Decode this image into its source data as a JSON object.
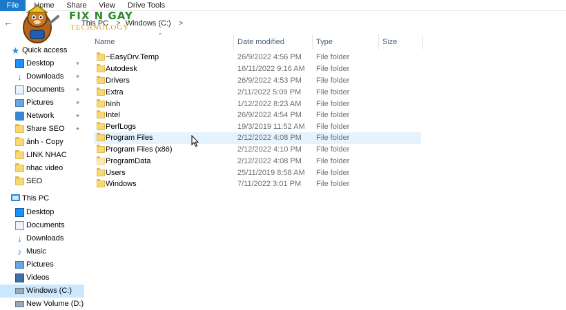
{
  "ribbon": {
    "tabs": [
      "File",
      "Home",
      "Share",
      "View",
      "Drive Tools"
    ]
  },
  "address": {
    "segments": [
      "This PC",
      "Windows (C:)"
    ],
    "separator": ">"
  },
  "logo": {
    "line1": "FIX N GAY",
    "line2": "TECHNOLOGY"
  },
  "columns": {
    "name": "Name",
    "date": "Date modified",
    "type": "Type",
    "size": "Size"
  },
  "nav": {
    "quick_access": "Quick access",
    "items": [
      {
        "label": "Desktop",
        "icon": "desktop-icon",
        "pinned": true
      },
      {
        "label": "Downloads",
        "icon": "download-icon",
        "pinned": true
      },
      {
        "label": "Documents",
        "icon": "documents-icon",
        "pinned": true
      },
      {
        "label": "Pictures",
        "icon": "pictures-icon",
        "pinned": true
      },
      {
        "label": "Network",
        "icon": "network-icon",
        "pinned": true
      },
      {
        "label": "Share SEO",
        "icon": "folder-icon",
        "pinned": true
      },
      {
        "label": "ảnh - Copy",
        "icon": "folder-icon",
        "pinned": false
      },
      {
        "label": "LINK NHAC",
        "icon": "folder-icon",
        "pinned": false
      },
      {
        "label": "nhạc video",
        "icon": "folder-icon",
        "pinned": false
      },
      {
        "label": "SEO",
        "icon": "folder-icon",
        "pinned": false
      }
    ],
    "this_pc": "This PC",
    "pc_items": [
      {
        "label": "Desktop",
        "icon": "desktop-icon"
      },
      {
        "label": "Documents",
        "icon": "documents-icon"
      },
      {
        "label": "Downloads",
        "icon": "download-icon"
      },
      {
        "label": "Music",
        "icon": "music-icon"
      },
      {
        "label": "Pictures",
        "icon": "pictures-icon"
      },
      {
        "label": "Videos",
        "icon": "videos-icon"
      },
      {
        "label": "Windows (C:)",
        "icon": "drive-icon",
        "selected": true
      },
      {
        "label": "New Volume (D:)",
        "icon": "drive-icon"
      }
    ],
    "pin_glyph": "📌"
  },
  "files": [
    {
      "name": "~EasyDrv.Temp",
      "date": "26/9/2022 4:56 PM",
      "type": "File folder"
    },
    {
      "name": "Autodesk",
      "date": "16/11/2022 9:16 AM",
      "type": "File folder"
    },
    {
      "name": "Drivers",
      "date": "26/9/2022 4:53 PM",
      "type": "File folder"
    },
    {
      "name": "Extra",
      "date": "2/11/2022 5:09 PM",
      "type": "File folder"
    },
    {
      "name": "hình",
      "date": "1/12/2022 8:23 AM",
      "type": "File folder"
    },
    {
      "name": "Intel",
      "date": "26/9/2022 4:54 PM",
      "type": "File folder"
    },
    {
      "name": "PerfLogs",
      "date": "19/3/2019 11:52 AM",
      "type": "File folder"
    },
    {
      "name": "Program Files",
      "date": "2/12/2022 4:08 PM",
      "type": "File folder",
      "hover": true
    },
    {
      "name": "Program Files (x86)",
      "date": "2/12/2022 4:10 PM",
      "type": "File folder"
    },
    {
      "name": "ProgramData",
      "date": "2/12/2022 4:08 PM",
      "type": "File folder",
      "light": true
    },
    {
      "name": "Users",
      "date": "25/11/2019 8:58 AM",
      "type": "File folder"
    },
    {
      "name": "Windows",
      "date": "7/11/2022 3:01 PM",
      "type": "File folder"
    }
  ],
  "colors": {
    "accent": "#1979ca",
    "selection": "#cce8ff",
    "hover": "#e5f3ff",
    "folder": "#f8d775"
  }
}
